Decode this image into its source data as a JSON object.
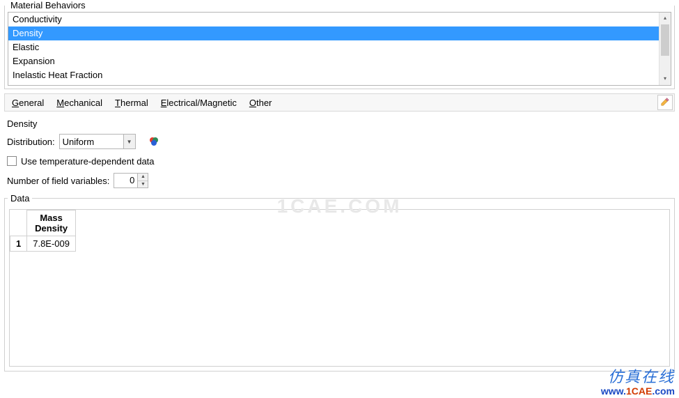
{
  "behaviors_panel": {
    "title": "Material Behaviors",
    "items": [
      "Conductivity",
      "Density",
      "Elastic",
      "Expansion",
      "Inelastic Heat Fraction"
    ],
    "selected_index": 1
  },
  "menubar": {
    "general": "eneral",
    "mechanical": "echanical",
    "thermal": "hermal",
    "electrical": "lectrical/Magnetic",
    "other": "ther"
  },
  "section_label": "Density",
  "distribution": {
    "label": "Distribution:",
    "value": "Uniform"
  },
  "temp_dep": {
    "label": "Use temperature-dependent data"
  },
  "field_vars": {
    "label": "Number of field variables:",
    "value": "0"
  },
  "data_panel": {
    "title": "Data",
    "col_header_line1": "Mass",
    "col_header_line2": "Density",
    "row1_index": "1",
    "row1_value": "7.8E-009"
  },
  "watermark": {
    "center": "1CAE.COM",
    "cn": "仿真在线",
    "url_prefix": "www.",
    "url_mid": "1CAE",
    "url_suffix": ".com"
  }
}
